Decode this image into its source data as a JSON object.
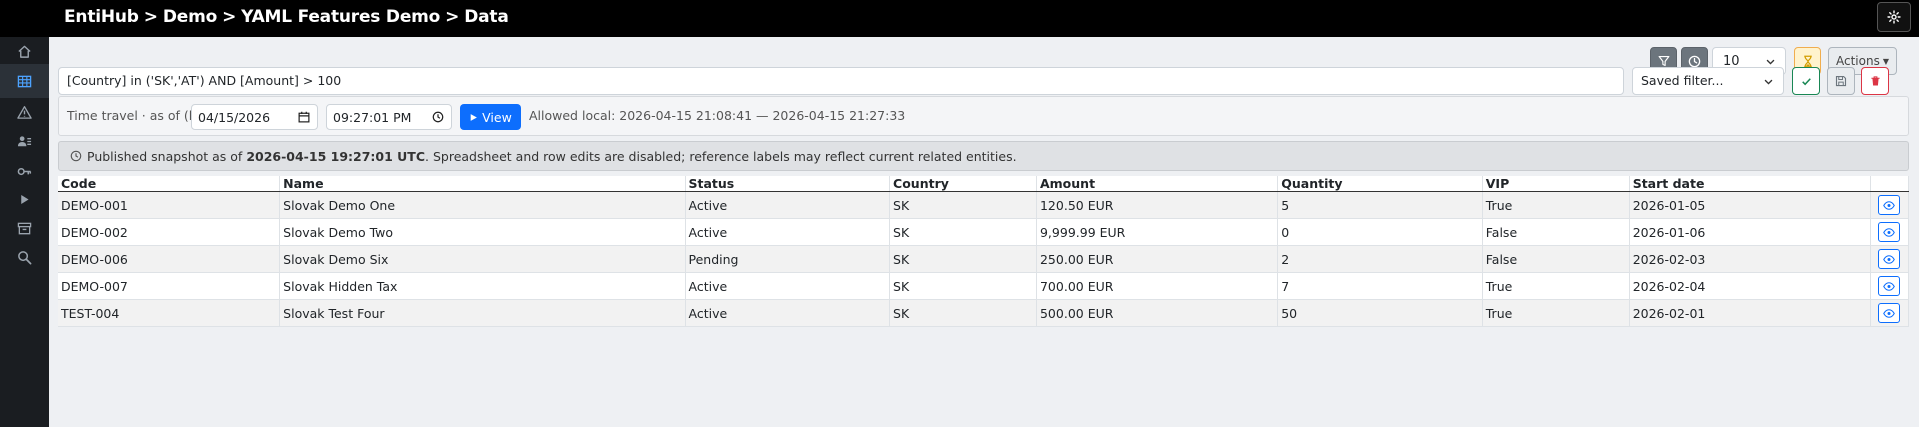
{
  "header": {
    "breadcrumb": [
      "EntiHub",
      "Demo",
      "YAML Features Demo",
      "Data"
    ],
    "separator": ">"
  },
  "sidebar": {
    "items": [
      {
        "icon": "home-icon"
      },
      {
        "icon": "table-icon",
        "active": true
      },
      {
        "icon": "warning-icon"
      },
      {
        "icon": "user-list-icon"
      },
      {
        "icon": "key-icon"
      },
      {
        "icon": "play-icon"
      },
      {
        "icon": "archive-icon"
      },
      {
        "icon": "search-icon"
      }
    ]
  },
  "toolbar": {
    "page_size": "10",
    "actions_label": "Actions"
  },
  "filter": {
    "expression": "[Country] in ('SK','AT') AND [Amount] > 100",
    "saved_filter_placeholder": "Saved filter..."
  },
  "time_travel": {
    "label": "Time travel · as of (local)",
    "date": "04/15/2026",
    "time": "09:27:01 PM",
    "view_label": "View",
    "allowed": "Allowed local: 2026-04-15 21:08:41 — 2026-04-15 21:27:33"
  },
  "snapshot": {
    "prefix": "Published snapshot as of ",
    "timestamp": "2026-04-15 19:27:01 UTC",
    "suffix": ". Spreadsheet and row edits are disabled; reference labels may reflect current related entities."
  },
  "table": {
    "columns": [
      "Code",
      "Name",
      "Status",
      "Country",
      "Amount",
      "Quantity",
      "VIP",
      "Start date"
    ],
    "rows": [
      [
        "DEMO-001",
        "Slovak Demo One",
        "Active",
        "SK",
        "120.50 EUR",
        "5",
        "True",
        "2026-01-05"
      ],
      [
        "DEMO-002",
        "Slovak Demo Two",
        "Active",
        "SK",
        "9,999.99 EUR",
        "0",
        "False",
        "2026-01-06"
      ],
      [
        "DEMO-006",
        "Slovak Demo Six",
        "Pending",
        "SK",
        "250.00 EUR",
        "2",
        "False",
        "2026-02-03"
      ],
      [
        "DEMO-007",
        "Slovak Hidden Tax",
        "Active",
        "SK",
        "700.00 EUR",
        "7",
        "True",
        "2026-02-04"
      ],
      [
        "TEST-004",
        "Slovak Test Four",
        "Active",
        "SK",
        "500.00 EUR",
        "50",
        "True",
        "2026-02-01"
      ]
    ]
  },
  "colors": {
    "header_bg": "#000000",
    "sidebar_bg": "#1a1d21",
    "primary": "#0d6efd",
    "success": "#198754",
    "danger": "#dc3545",
    "warning": "#f0ad4e"
  }
}
